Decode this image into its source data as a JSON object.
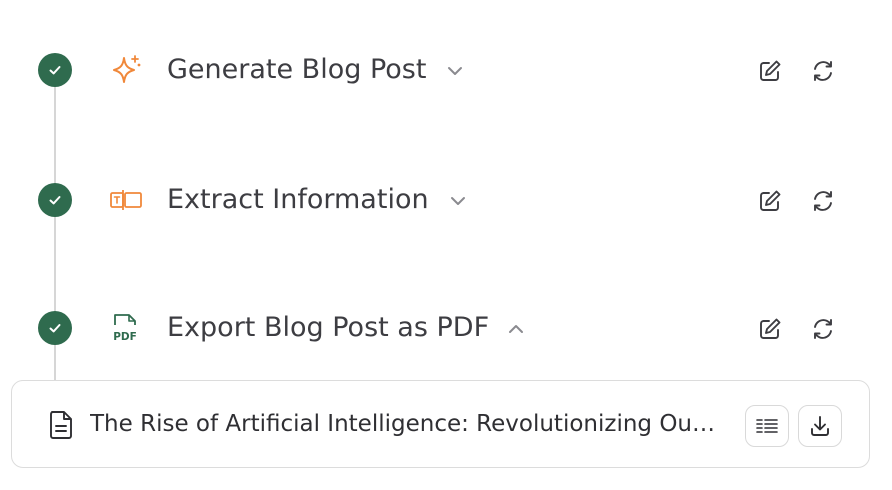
{
  "colors": {
    "check_green": "#2f6b4e",
    "accent_orange": "#f0883a",
    "pdf_green": "#2f6b4e",
    "text": "#3d3d42"
  },
  "steps": [
    {
      "title": "Generate Blog Post",
      "icon": "sparkle-icon",
      "expanded": false,
      "status": "completed"
    },
    {
      "title": "Extract Information",
      "icon": "text-extract-icon",
      "expanded": false,
      "status": "completed"
    },
    {
      "title": "Export Blog Post as PDF",
      "icon": "pdf-file-icon",
      "icon_label": "PDF",
      "expanded": true,
      "status": "completed"
    }
  ],
  "output_file": {
    "icon": "document-icon",
    "title": "The Rise of Artificial Intelligence: Revolutionizing Our World",
    "actions": [
      "preview-icon",
      "download-icon"
    ]
  }
}
